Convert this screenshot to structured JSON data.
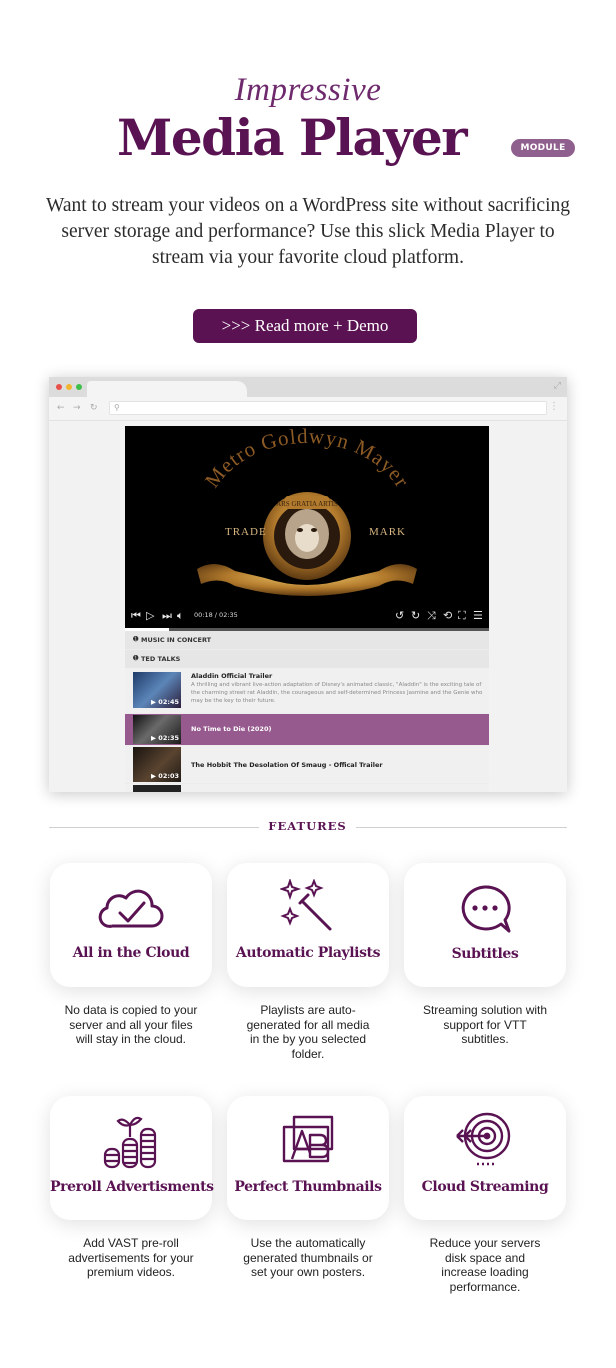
{
  "header": {
    "kicker": "Impressive",
    "title": "Media Player",
    "badge": "MODULE",
    "intro": "Want to stream your videos on a WordPress site without sacrificing server storage and performance? Use this slick Media Player to stream via your favorite cloud platform.",
    "cta_label": ">>> Read more + Demo"
  },
  "browser": {
    "traffic_lights": [
      "#e8504a",
      "#f2b52f",
      "#3fbf4a"
    ],
    "player": {
      "video_text": {
        "arc": "Metro Goldwyn Mayer",
        "left": "TRADE",
        "right": "MARK",
        "ribbon": "ARS GRATIA ARTIS"
      },
      "timecode": "00:18 / 02:35",
      "progress": 0.12,
      "categories": [
        "MUSIC IN CONCERT",
        "TED TALKS"
      ],
      "playlist": [
        {
          "title": "Aladdin Official Trailer",
          "duration": "02:45",
          "description": "A thrilling and vibrant live-action adaptation of Disney's animated classic, \"Aladdin\" is the exciting tale of the charming street rat Aladdin, the courageous and self-determined Princess Jasmine and the Genie who may be the key to their future.",
          "active": false
        },
        {
          "title": "No Time to Die (2020)",
          "duration": "02:35",
          "description": "",
          "active": true
        },
        {
          "title": "The Hobbit The Desolation Of Smaug - Offical Trailer",
          "duration": "02:03",
          "description": "",
          "active": false
        }
      ]
    }
  },
  "features": {
    "heading": "FEATURES",
    "items": [
      {
        "icon": "cloud-check-icon",
        "title": "All in the Cloud",
        "description": "No data is copied to your server and all your files will stay in the cloud."
      },
      {
        "icon": "magic-wand-icon",
        "title": "Automatic Playlists",
        "description": "Playlists are auto-generated for all media in the by you selected folder."
      },
      {
        "icon": "chat-bubble-icon",
        "title": "Subtitles",
        "description": "Streaming solution with support for VTT subtitles."
      },
      {
        "icon": "coin-stacks-icon",
        "title": "Preroll Advertisments",
        "description": "Add VAST pre-roll advertisements for your premium videos."
      },
      {
        "icon": "thumbnail-icon",
        "title": "Perfect Thumbnails",
        "description": "Use the automatically generated thumbnails or set your own posters."
      },
      {
        "icon": "target-icon",
        "title": "Cloud Streaming",
        "description": "Reduce your servers disk space and increase loading performance."
      }
    ]
  },
  "colors": {
    "brand": "#5a1352",
    "badge": "#8f5f8d",
    "active_item": "#965a8f"
  }
}
